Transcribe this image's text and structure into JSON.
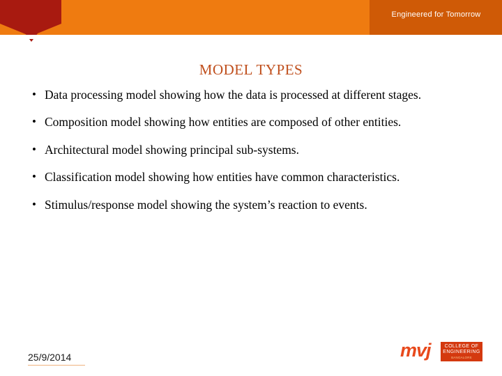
{
  "banner": {
    "tagline": "Engineered for Tomorrow",
    "accent_orange": "#ef7b10",
    "accent_dark_orange": "#cf5a06",
    "accent_red": "#a81a10"
  },
  "slide": {
    "title": "MODEL TYPES",
    "title_color": "#c0501e",
    "bullets": [
      "Data processing model showing how the data is processed at different stages.",
      "Composition model showing how entities are composed of other entities.",
      "Architectural model showing principal sub-systems.",
      "Classification model showing how entities have common characteristics.",
      "Stimulus/response model showing the system’s reaction to events."
    ]
  },
  "footer": {
    "date": "25/9/2014"
  },
  "logo": {
    "wordmark": "mvj",
    "line1": "COLLEGE OF",
    "line2": "ENGINEERING",
    "line3": "BANGALORE",
    "color": "#e8491c",
    "box_color": "#d4390f"
  }
}
